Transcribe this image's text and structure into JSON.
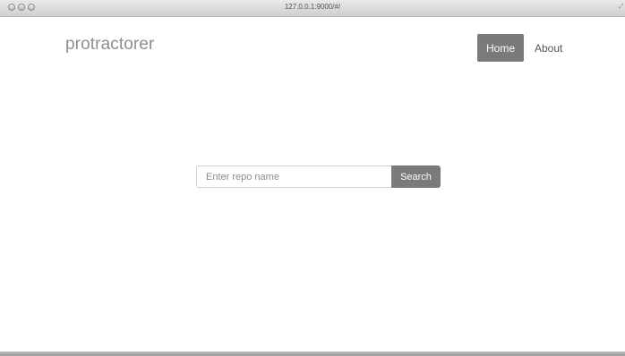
{
  "browser": {
    "url": "127.0.0.1:9000/#/"
  },
  "header": {
    "brand": "protractorer",
    "nav": {
      "home_label": "Home",
      "about_label": "About"
    }
  },
  "search": {
    "placeholder": "Enter repo name",
    "value": "",
    "button_label": "Search"
  },
  "colors": {
    "accent": "#7a7a7a",
    "brand_text": "#8e8e8e"
  }
}
